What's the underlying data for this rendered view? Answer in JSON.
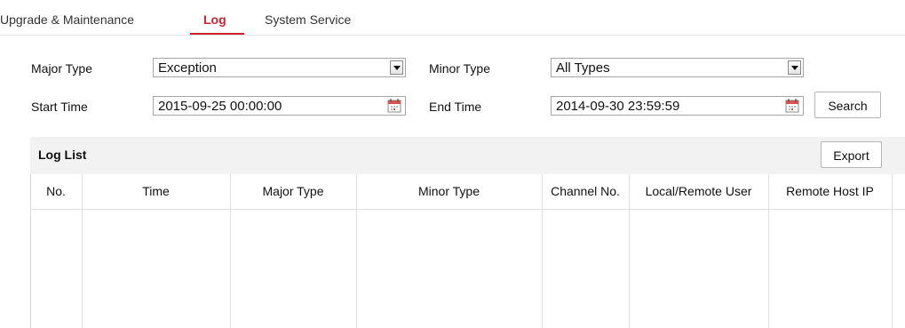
{
  "tabs": [
    {
      "label": "Upgrade & Maintenance",
      "active": false
    },
    {
      "label": "Log",
      "active": true
    },
    {
      "label": "System Service",
      "active": false
    }
  ],
  "filters": {
    "major_type_label": "Major Type",
    "major_type_value": "Exception",
    "minor_type_label": "Minor Type",
    "minor_type_value": "All Types",
    "start_time_label": "Start Time",
    "start_time_value": "2015-09-25 00:00:00",
    "end_time_label": "End Time",
    "end_time_value": "2014-09-30 23:59:59",
    "search_label": "Search"
  },
  "log_list": {
    "title": "Log List",
    "export_label": "Export",
    "columns": [
      "No.",
      "Time",
      "Major Type",
      "Minor Type",
      "Channel No.",
      "Local/Remote User",
      "Remote Host IP"
    ],
    "rows": []
  },
  "colors": {
    "accent": "#d0202a",
    "panel_header_bg": "#f2f2f2",
    "border": "#a6a6a6"
  },
  "icons": {
    "dropdown": "chevron-down-icon",
    "calendar": "calendar-icon"
  }
}
